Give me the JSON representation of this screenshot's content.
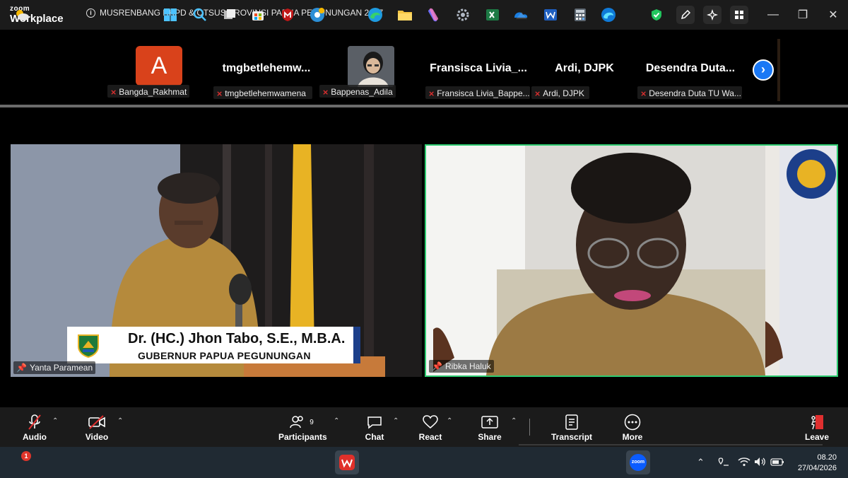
{
  "app": {
    "brand_top": "zoom",
    "brand_bottom": "Workplace"
  },
  "meeting": {
    "title": "MUSRENBANG RKPD & OTSUS PROVINSI PAPUA PEGUNUNGAN 2027"
  },
  "titlebar_icons": [
    "shield-check-icon",
    "annotate-pen-icon",
    "ai-sparkle-icon",
    "apps-grid-icon"
  ],
  "window_controls": {
    "minimize": "—",
    "restore": "❐",
    "close": "✕"
  },
  "gallery": {
    "tiles": [
      {
        "label": "Bangda_Rakhmat",
        "avatar_letter": "A",
        "muted": true
      },
      {
        "display": "tmgbetlehemw...",
        "label": "tmgbetlehemwamena",
        "muted": true
      },
      {
        "label": "Bappenas_Adila",
        "muted": true
      },
      {
        "display": "Fransisca Livia_...",
        "label": "Fransisca Livia_Bappe...",
        "muted": true
      },
      {
        "display": "Ardi, DJPK",
        "label": "Ardi, DJPK",
        "muted": true
      },
      {
        "display": "Desendra Duta...",
        "label": "Desendra Duta TU Wa...",
        "muted": true
      }
    ],
    "next_icon": "chevron-right-icon"
  },
  "speakers": [
    {
      "name": "Yanta Paramean",
      "caption_name": "Dr. (HC.) Jhon Tabo, S.E., M.B.A.",
      "caption_title": "GUBERNUR PAPUA PEGUNUNGAN"
    },
    {
      "name": "Ribka Haluk",
      "active_speaker": true,
      "accent": "#2ecc71"
    }
  ],
  "toolbar": {
    "audio": "Audio",
    "video": "Video",
    "participants": "Participants",
    "participants_count": "9",
    "chat": "Chat",
    "react": "React",
    "share": "Share",
    "transcript": "Transcript",
    "more": "More",
    "leave": "Leave"
  },
  "taskbar": {
    "apps": [
      "windows-start-icon",
      "search-icon",
      "task-view-icon",
      "store-icon",
      "mcafee-icon",
      "chrome-icon",
      "wps-office-icon",
      "edge-icon",
      "file-explorer-icon",
      "copilot-icon",
      "settings-icon",
      "excel-icon",
      "onedrive-icon",
      "word-icon",
      "calculator-icon",
      "edge-dev-icon",
      "zoom-icon"
    ],
    "weather_badge": "1",
    "zoom_label": "zoom",
    "time": "08.20",
    "date": "27/04/2026"
  },
  "colors": {
    "accent_blue": "#1a78f5",
    "leave_red": "#e02f2f",
    "active_border": "#2ecc71",
    "avatar_orange": "#d9421b"
  }
}
